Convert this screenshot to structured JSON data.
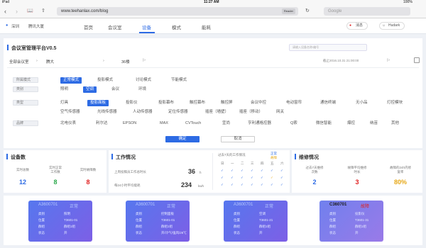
{
  "status": {
    "left": "iPad",
    "time": "11:27 AM",
    "battery": "100%"
  },
  "browser": {
    "url": "www.teehanlax.com/blog",
    "reader": "Reader",
    "search_placeholder": "Google"
  },
  "nav": {
    "location_city": "深圳",
    "location_building": "腾讯大厦",
    "tabs": [
      "首页",
      "会议室",
      "设备",
      "模式",
      "能耗"
    ],
    "active_tab": "设备",
    "messages": "消息",
    "user": "Hudark"
  },
  "main": {
    "title": "会议室管理平台V0.5",
    "search_placeholder": "请输入设备名称/编号",
    "breadcrumb": [
      "全部会议室",
      "腾大",
      "36楼"
    ],
    "updated": "截止2016.10.31  21:00:00",
    "filters": [
      {
        "label": "所属模式",
        "options": [
          "正常模式",
          "投影模式",
          "讨论模式",
          "节能模式"
        ],
        "selected": "正常模式"
      },
      {
        "label": "类别",
        "options": [
          "照明",
          "空调",
          "会议",
          "环境"
        ],
        "selected": "空调"
      },
      {
        "label": "类型",
        "options": [
          "灯具",
          "投影面板",
          "投影仪",
          "投影幕布",
          "触控幕布",
          "触控屏",
          "会议中控",
          "电动窗帘",
          "通信终端",
          "无小品",
          "灯控模块",
          "空气传感器",
          "光线传感器",
          "人动传感器",
          "定位传感器",
          "插座（墙壁）",
          "插座（移动）",
          "网关"
        ],
        "selected": "投影面板"
      },
      {
        "label": "品牌",
        "options": [
          "北电仪表",
          "利尔达",
          "EPSON",
          "MAX",
          "CVTouch",
          "宜尚",
          "亨利通格控器",
          "Q索",
          "微信智能",
          "爆控",
          "纳苗",
          "其他"
        ],
        "selected": ""
      }
    ],
    "confirm": "确定",
    "cancel": "取消"
  },
  "device_count": {
    "title": "设备数",
    "items": [
      {
        "label": "实时总数",
        "value": "12",
        "color": "#2d6be4"
      },
      {
        "label": "实时正常\n工作数",
        "value": "8",
        "color": "#2aa84a"
      },
      {
        "label": "实时故障数",
        "value": "8",
        "color": "#e02020"
      }
    ]
  },
  "work": {
    "title": "工作情况",
    "rows": [
      {
        "label": "上周投稿员工作总时长",
        "value": "36",
        "unit": "h"
      },
      {
        "label": "每24小时平均能耗",
        "value": "234",
        "unit": "kwh"
      }
    ],
    "week_title": "过去7天的工作情况",
    "legend": [
      "正常",
      "故障"
    ],
    "weekdays": [
      "日",
      "一",
      "二",
      "三",
      "四",
      "五",
      "六"
    ]
  },
  "maintenance": {
    "title": "维修情况",
    "items": [
      {
        "label": "过去7天维修\n次数",
        "value": "2",
        "color": "#2d6be4"
      },
      {
        "label": "故障平均维修\n时长",
        "value": "3",
        "color": "#e02020"
      },
      {
        "label": "故障的24h内修\n复率",
        "value": "80%",
        "color": "#e6a817"
      }
    ]
  },
  "devices": [
    {
      "id": "A3600701",
      "state": "正常",
      "rows": [
        [
          "类别",
          "照明"
        ],
        [
          "位置",
          "T3601-01"
        ],
        [
          "群组",
          "群组1组"
        ],
        [
          "状态",
          "开"
        ]
      ]
    },
    {
      "id": "A3600701",
      "state": "正常",
      "rows": [
        [
          "类别",
          "控制面板"
        ],
        [
          "位置",
          "T3601-01"
        ],
        [
          "群组",
          "群组1组"
        ],
        [
          "状态",
          "开/冷气/强风/26℃"
        ]
      ]
    },
    {
      "id": "A3600701",
      "state": "正常",
      "rows": [
        [
          "类别",
          "空调"
        ],
        [
          "位置",
          "T3601-21"
        ],
        [
          "群组",
          "群组1组"
        ],
        [
          "状态",
          "开"
        ]
      ]
    },
    {
      "id": "C360701",
      "state": "故障",
      "rows": [
        [
          "类别",
          "投影仪"
        ],
        [
          "位置",
          "T3601-31"
        ],
        [
          "群组",
          "群组1组"
        ],
        [
          "状态",
          "开"
        ]
      ]
    }
  ],
  "colors": {
    "accent": "#2d6be4",
    "ok": "#2aa84a",
    "fault": "#e02020",
    "warn": "#e6a817"
  }
}
